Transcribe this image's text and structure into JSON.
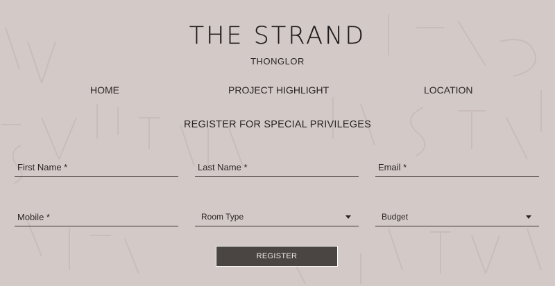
{
  "brand": {
    "title": "THE STRAND",
    "subtitle": "THONGLOR"
  },
  "nav": {
    "items": [
      {
        "label": "HOME"
      },
      {
        "label": "PROJECT HIGHLIGHT"
      },
      {
        "label": "LOCATION"
      }
    ]
  },
  "form": {
    "title": "REGISTER FOR SPECIAL PRIVILEGES",
    "first_name": {
      "placeholder": "First Name *",
      "value": ""
    },
    "last_name": {
      "placeholder": "Last Name *",
      "value": ""
    },
    "email": {
      "placeholder": "Email *",
      "value": ""
    },
    "mobile": {
      "placeholder": "Mobile *",
      "value": ""
    },
    "room_type": {
      "selected": "Room Type"
    },
    "budget": {
      "selected": "Budget"
    },
    "submit_label": "REGISTER"
  },
  "colors": {
    "background": "#d3c9c7",
    "text": "#2a2526",
    "button_bg": "#4a4443",
    "button_text": "#f3eeec"
  }
}
